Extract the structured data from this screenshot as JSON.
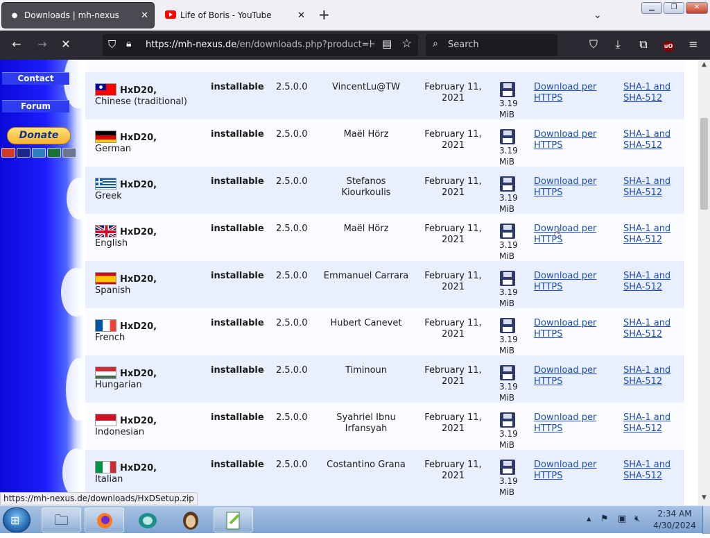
{
  "tabs": [
    {
      "title": "Downloads | mh-nexus",
      "favicon": "loading-dot-icon"
    },
    {
      "title": "Life of Boris - YouTube",
      "favicon": "youtube-icon"
    }
  ],
  "url": {
    "host": "https://mh-nexus.de",
    "path": "/en/downloads.php?product=HxD"
  },
  "search_placeholder": "Search",
  "sidebar": {
    "contact": "Contact",
    "forum": "Forum",
    "donate": "Donate"
  },
  "rows": [
    {
      "product": "HxD20,",
      "language": "Chinese (traditional)",
      "flag": "taiwan",
      "kind": "installable",
      "version": "2.5.0.0",
      "author": "VincentLu@TW",
      "date": "February 11, 2021",
      "size": "3.19 MiB",
      "download": "Download per HTTPS",
      "hash": "SHA-1 and SHA-512"
    },
    {
      "product": "HxD20,",
      "language": "German",
      "flag": "germany",
      "kind": "installable",
      "version": "2.5.0.0",
      "author": "Maël Hörz",
      "date": "February 11, 2021",
      "size": "3.19 MiB",
      "download": "Download per HTTPS",
      "hash": "SHA-1 and SHA-512"
    },
    {
      "product": "HxD20,",
      "language": "Greek",
      "flag": "greece",
      "kind": "installable",
      "version": "2.5.0.0",
      "author": "Stefanos Kiourkoulis",
      "date": "February 11, 2021",
      "size": "3.19 MiB",
      "download": "Download per HTTPS",
      "hash": "SHA-1 and SHA-512"
    },
    {
      "product": "HxD20,",
      "language": "English",
      "flag": "uk",
      "kind": "installable",
      "version": "2.5.0.0",
      "author": "Maël Hörz",
      "date": "February 11, 2021",
      "size": "3.19 MiB",
      "download": "Download per HTTPS",
      "hash": "SHA-1 and SHA-512"
    },
    {
      "product": "HxD20,",
      "language": "Spanish",
      "flag": "spain",
      "kind": "installable",
      "version": "2.5.0.0",
      "author": "Emmanuel Carrara",
      "date": "February 11, 2021",
      "size": "3.19 MiB",
      "download": "Download per HTTPS",
      "hash": "SHA-1 and SHA-512"
    },
    {
      "product": "HxD20,",
      "language": "French",
      "flag": "france",
      "kind": "installable",
      "version": "2.5.0.0",
      "author": "Hubert Canevet",
      "date": "February 11, 2021",
      "size": "3.19 MiB",
      "download": "Download per HTTPS",
      "hash": "SHA-1 and SHA-512"
    },
    {
      "product": "HxD20,",
      "language": "Hungarian",
      "flag": "hungary",
      "kind": "installable",
      "version": "2.5.0.0",
      "author": "Timinoun",
      "date": "February 11, 2021",
      "size": "3.19 MiB",
      "download": "Download per HTTPS",
      "hash": "SHA-1 and SHA-512"
    },
    {
      "product": "HxD20,",
      "language": "Indonesian",
      "flag": "indonesia",
      "kind": "installable",
      "version": "2.5.0.0",
      "author": "Syahriel Ibnu Irfansyah",
      "date": "February 11, 2021",
      "size": "3.19 MiB",
      "download": "Download per HTTPS",
      "hash": "SHA-1 and SHA-512"
    },
    {
      "product": "HxD20,",
      "language": "Italian",
      "flag": "italy",
      "kind": "installable",
      "version": "2.5.0.0",
      "author": "Costantino Grana",
      "date": "February 11, 2021",
      "size": "3.19 MiB",
      "download": "Download per HTTPS",
      "hash": "SHA-1 and SHA-512"
    }
  ],
  "status_url": "https://mh-nexus.de/downloads/HxDSetup.zip",
  "clock": {
    "time": "2:34 AM",
    "date": "4/30/2024"
  },
  "colors": {
    "sidebar_blue": "#1d1dff",
    "link": "#1a4fb8",
    "row_shade": "#e9efff"
  }
}
